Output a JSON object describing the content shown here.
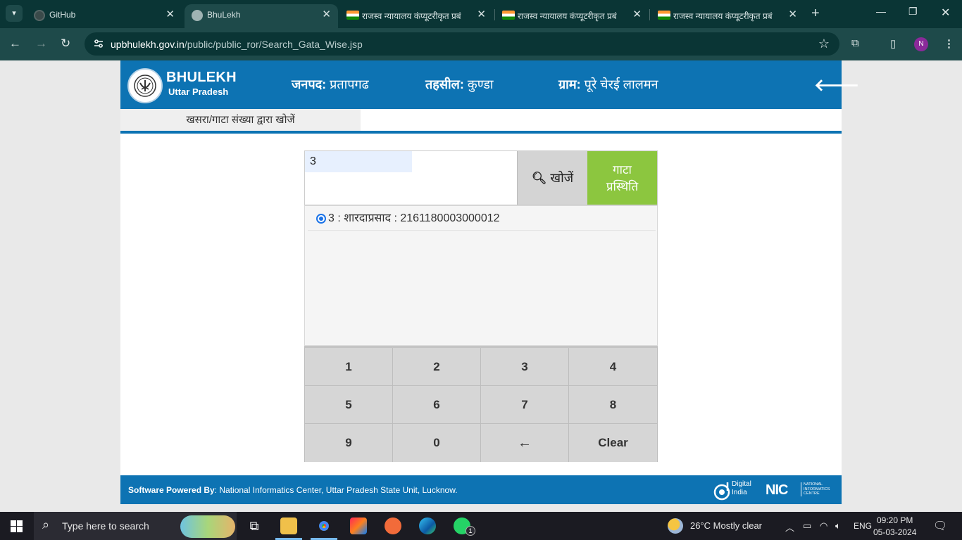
{
  "browser": {
    "tabs": [
      {
        "title": "GitHub",
        "favicon": "github-icon",
        "active": false
      },
      {
        "title": "BhuLekh",
        "favicon": "globe-icon",
        "active": true
      },
      {
        "title": "राजस्व न्यायालय कंप्यूटरीकृत प्रबं",
        "favicon": "india-flag-icon",
        "active": false
      },
      {
        "title": "राजस्व न्यायालय कंप्यूटरीकृत प्रबं",
        "favicon": "india-flag-icon",
        "active": false
      },
      {
        "title": "राजस्व न्यायालय कंप्यूटरीकृत प्रबं",
        "favicon": "india-flag-icon",
        "active": false
      }
    ],
    "url_host": "upbhulekh.gov.in",
    "url_path": "/public/public_ror/Search_Gata_Wise.jsp",
    "profile_initial": "N"
  },
  "header": {
    "brand_title": "BHULEKH",
    "brand_sub": "Uttar Pradesh",
    "janpad_label": "जनपद:",
    "janpad_value": "प्रतापगढ",
    "tehsil_label": "तहसील:",
    "tehsil_value": "कुण्डा",
    "gram_label": "ग्राम:",
    "gram_value": "पूरे चेरई लालमन"
  },
  "subnav": {
    "active_tab": "खसरा/गाटा संख्या द्वारा खोजें"
  },
  "search": {
    "input_value": "3",
    "search_button": "खोजें",
    "status_button_line1": "गाटा",
    "status_button_line2": "प्रस्थिति"
  },
  "results": [
    {
      "text": "3 : शारदाप्रसाद : 2161180003000012",
      "selected": true
    }
  ],
  "keypad": {
    "keys": [
      "1",
      "2",
      "3",
      "4",
      "5",
      "6",
      "7",
      "8",
      "9",
      "0",
      "←",
      "Clear"
    ]
  },
  "footer": {
    "powered_label": "Software Powered By",
    "powered_text": ": National Informatics Center, Uttar Pradesh State Unit, Lucknow.",
    "digital_india_1": "Digital",
    "digital_india_2": "India",
    "nic_logo": "NIC",
    "nic_text_1": "NATIONAL",
    "nic_text_2": "INFORMATICS",
    "nic_text_3": "CENTRE"
  },
  "taskbar": {
    "search_placeholder": "Type here to search",
    "weather": "26°C  Mostly clear",
    "language": "ENG",
    "time": "09:20 PM",
    "date": "05-03-2024",
    "whatsapp_badge": "1"
  },
  "colors": {
    "site_blue": "#0d73b3",
    "status_green": "#8cc63f",
    "chrome_dark": "#0a3535",
    "chrome_toolbar": "#1e4a4a"
  }
}
